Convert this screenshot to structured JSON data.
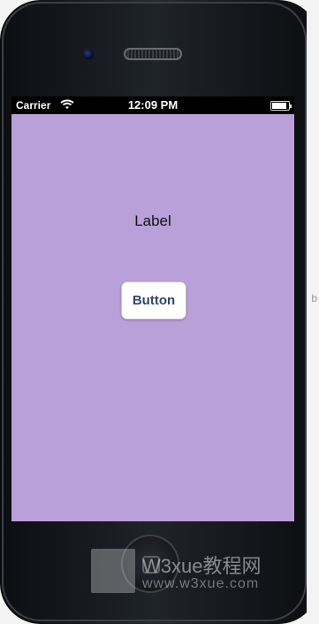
{
  "status_bar": {
    "carrier": "Carrier",
    "time": "12:09 PM",
    "wifi_icon": "wifi-icon",
    "battery_icon": "battery-icon"
  },
  "app": {
    "background_color": "#b9a0d8",
    "label_text": "Label",
    "button_label": "Button",
    "button_text_color": "#30456a"
  },
  "watermark": {
    "title": "W3xue教程网",
    "url": "www.w3xue.com"
  },
  "edge_glyph": "b"
}
